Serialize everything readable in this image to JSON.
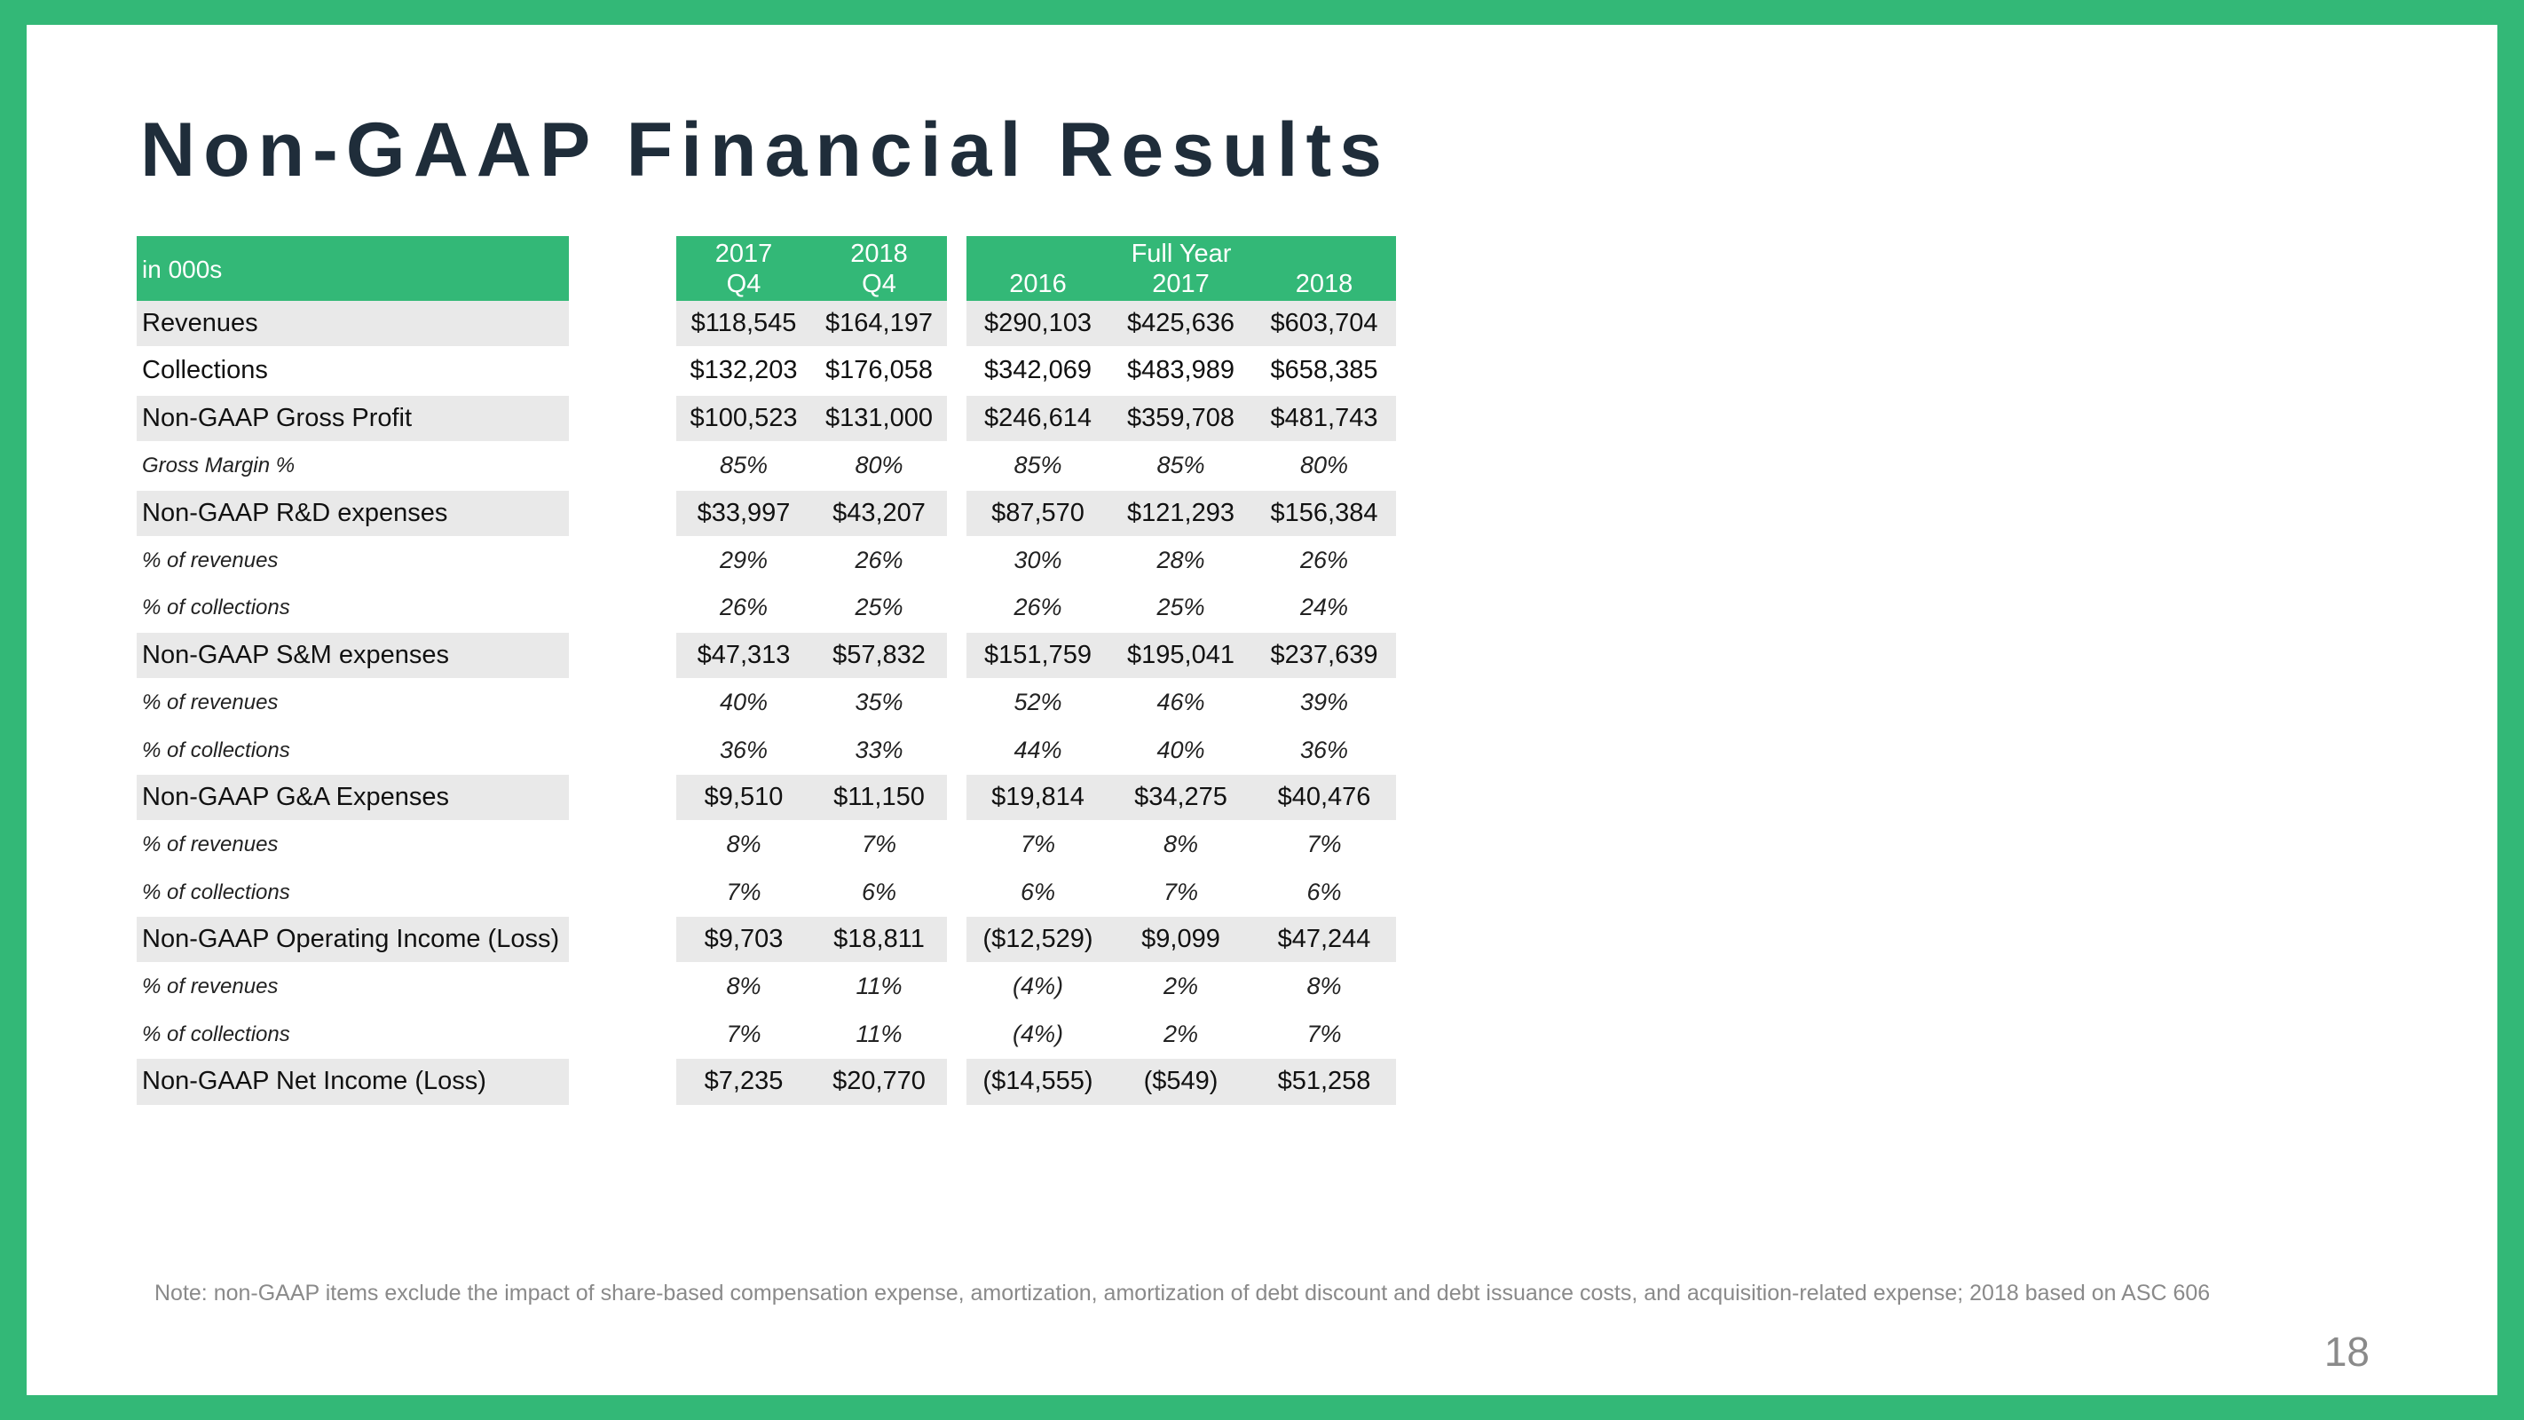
{
  "title": "Non-GAAP Financial Results",
  "table": {
    "unit_label": "in 000s",
    "quarter_headers": [
      {
        "year": "2017",
        "period": "Q4"
      },
      {
        "year": "2018",
        "period": "Q4"
      }
    ],
    "full_year_label": "Full Year",
    "full_year_headers": [
      "2016",
      "2017",
      "2018"
    ],
    "rows": [
      {
        "label": "Revenues",
        "type": "main",
        "values": [
          "$118,545",
          "$164,197",
          "$290,103",
          "$425,636",
          "$603,704"
        ]
      },
      {
        "label": "Collections",
        "type": "main-plain",
        "values": [
          "$132,203",
          "$176,058",
          "$342,069",
          "$483,989",
          "$658,385"
        ]
      },
      {
        "label": "Non-GAAP Gross Profit",
        "type": "main",
        "values": [
          "$100,523",
          "$131,000",
          "$246,614",
          "$359,708",
          "$481,743"
        ]
      },
      {
        "label": "Gross Margin %",
        "type": "sub",
        "values": [
          "85%",
          "80%",
          "85%",
          "85%",
          "80%"
        ]
      },
      {
        "label": "Non-GAAP R&D expenses",
        "type": "main",
        "values": [
          "$33,997",
          "$43,207",
          "$87,570",
          "$121,293",
          "$156,384"
        ]
      },
      {
        "label": "% of revenues",
        "type": "sub",
        "values": [
          "29%",
          "26%",
          "30%",
          "28%",
          "26%"
        ]
      },
      {
        "label": "% of collections",
        "type": "sub",
        "values": [
          "26%",
          "25%",
          "26%",
          "25%",
          "24%"
        ]
      },
      {
        "label": "Non-GAAP S&M expenses",
        "type": "main",
        "values": [
          "$47,313",
          "$57,832",
          "$151,759",
          "$195,041",
          "$237,639"
        ]
      },
      {
        "label": "% of revenues",
        "type": "sub",
        "values": [
          "40%",
          "35%",
          "52%",
          "46%",
          "39%"
        ]
      },
      {
        "label": "% of collections",
        "type": "sub",
        "values": [
          "36%",
          "33%",
          "44%",
          "40%",
          "36%"
        ]
      },
      {
        "label": "Non-GAAP G&A Expenses",
        "type": "main",
        "values": [
          "$9,510",
          "$11,150",
          "$19,814",
          "$34,275",
          "$40,476"
        ]
      },
      {
        "label": "% of revenues",
        "type": "sub",
        "values": [
          "8%",
          "7%",
          "7%",
          "8%",
          "7%"
        ]
      },
      {
        "label": "% of collections",
        "type": "sub",
        "values": [
          "7%",
          "6%",
          "6%",
          "7%",
          "6%"
        ]
      },
      {
        "label": "Non-GAAP Operating Income (Loss)",
        "type": "main",
        "values": [
          "$9,703",
          "$18,811",
          "($12,529)",
          "$9,099",
          "$47,244"
        ]
      },
      {
        "label": "% of revenues",
        "type": "sub",
        "values": [
          "8%",
          "11%",
          "(4%)",
          "2%",
          "8%"
        ]
      },
      {
        "label": "% of collections",
        "type": "sub",
        "values": [
          "7%",
          "11%",
          "(4%)",
          "2%",
          "7%"
        ]
      },
      {
        "label": "Non-GAAP Net Income (Loss)",
        "type": "main",
        "values": [
          "$7,235",
          "$20,770",
          "($14,555)",
          "($549)",
          "$51,258"
        ]
      }
    ]
  },
  "note": "Note: non-GAAP items exclude the impact of share-based compensation expense, amortization, amortization of debt discount and debt issuance costs, and acquisition-related expense; 2018 based on ASC 606",
  "page_number": "18",
  "colors": {
    "accent": "#33b877",
    "title": "#1f2d3a",
    "row_shade": "#e9e9e9"
  }
}
